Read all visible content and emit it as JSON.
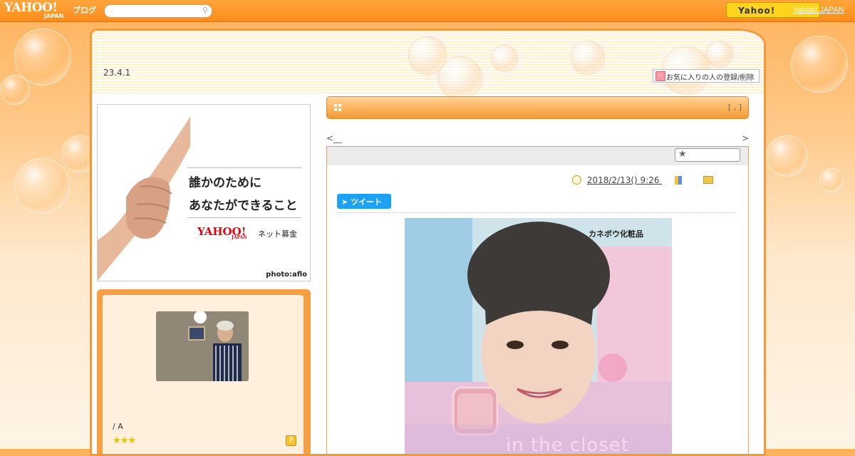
{
  "topbar": {
    "logo": "YAHOO!",
    "logo_sub": "JAPAN",
    "blog_label": "ブログ",
    "search_placeholder": "",
    "yahoo_button_label": "Yahoo!",
    "yahoo_japan_link": "Yahoo! JAPAN"
  },
  "header": {
    "date": "23.4.1",
    "favorite_button": "お気に入りの人の登録/削除"
  },
  "ad": {
    "line1": "誰かのために",
    "line2": "あなたができること",
    "brand": "YAHOO!",
    "brand_sub": "JAPAN",
    "service": "ネット募金",
    "credit": "photo:aflo"
  },
  "profile": {
    "name": "/ A",
    "stars": "★★★",
    "help_icon": "?"
  },
  "main": {
    "bar_right": "[ , ]",
    "nav_prev": "<__",
    "nav_next": ">",
    "post": {
      "datetime": "2018/2/13()  9:26   ",
      "tweet_label": "ツイート",
      "image_brand": "カネボウ化粧品",
      "image_caption": "in the closet"
    }
  },
  "colors": {
    "accent": "#f7a043",
    "topbar": "#fb8c1c",
    "tweet": "#1da1f2",
    "yahoo_button": "#ffd41e"
  }
}
